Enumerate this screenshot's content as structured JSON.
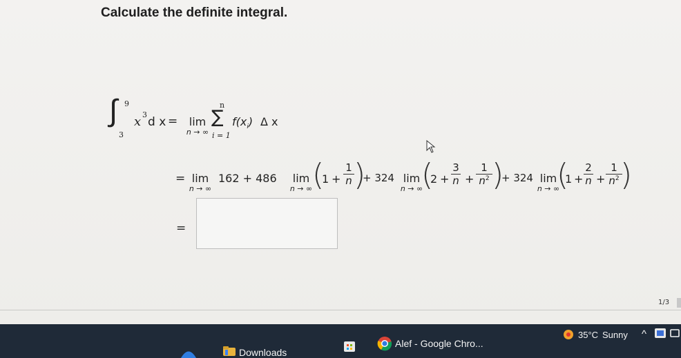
{
  "question": {
    "title": "Calculate the definite integral."
  },
  "equation": {
    "integral": {
      "upper": "9",
      "lower": "3",
      "integrand_base": "x",
      "integrand_exp": "3",
      "dx": "d x",
      "eq": "="
    },
    "riemann": {
      "lim_word": "lim",
      "lim_sub": "n → ∞",
      "sum_top": "n",
      "sum_bottom": "i = 1",
      "body": "f(x",
      "body_sub": "i",
      "body_end": ")",
      "delta": "Δ x"
    },
    "line2": {
      "eq": "=",
      "lim_word": "lim",
      "lim_sub": "n → ∞",
      "term1": "162 + 486",
      "term2_plus": "+ 324",
      "term3_plus": "+ 324",
      "p1": {
        "one": "1",
        "plus": "+",
        "num": "1",
        "den": "n"
      },
      "p2": {
        "two": "2",
        "plus1": "+",
        "num1": "3",
        "den1": "n",
        "plus2": "+",
        "num2": "1",
        "den2_base": "n",
        "den2_exp": "2"
      },
      "p3": {
        "one": "1",
        "plus1": "+",
        "num1": "2",
        "den1": "n",
        "plus2": "+",
        "num2": "1",
        "den2_base": "n",
        "den2_exp": "2"
      }
    },
    "line3": {
      "eq": "="
    }
  },
  "answer_input": {
    "value": ""
  },
  "pager": {
    "text": "1/3"
  },
  "taskbar": {
    "downloads_label": "Downloads",
    "chrome_label": "Alef - Google Chro...",
    "weather_temp": "35°C",
    "weather_cond": "Sunny",
    "tray_chevron": "^"
  },
  "colors": {
    "taskbar_bg": "#1f2a38",
    "page_bg": "#f1f0ee",
    "weather_icon": "#f0a12c",
    "chrome_blue": "#2f7de1"
  },
  "icons": [
    "cursor-arrow-icon",
    "folder-icon",
    "store-icon",
    "chrome-icon",
    "sun-icon",
    "chevron-up-icon",
    "tray-app-icon",
    "notification-icon"
  ]
}
